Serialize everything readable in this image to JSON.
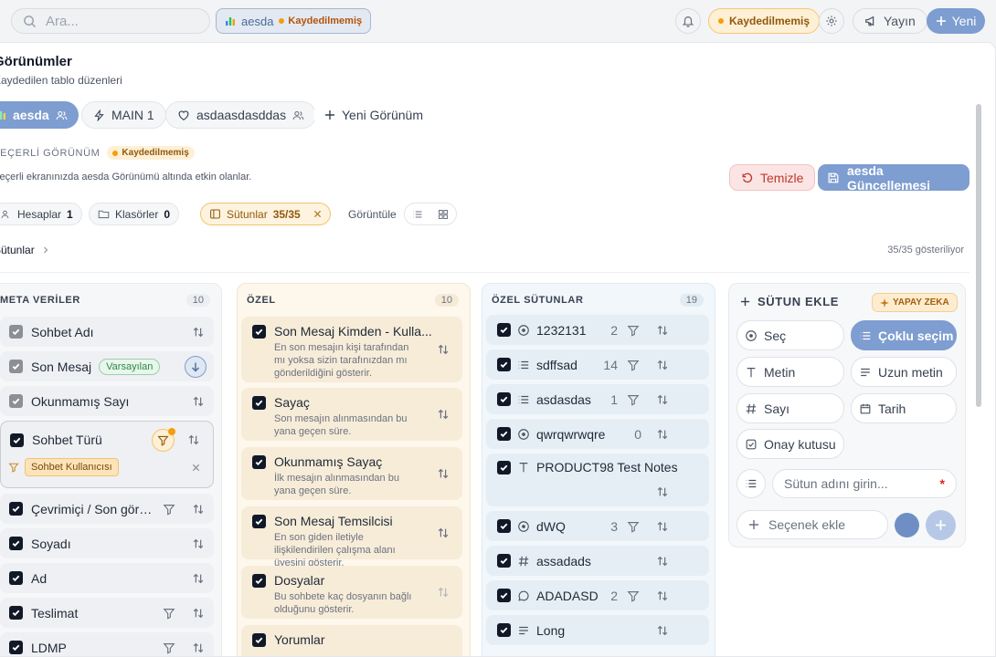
{
  "topbar": {
    "search_placeholder": "Ara...",
    "active_view": "aesda",
    "active_view_status": "Kaydedilmemiş",
    "unsaved_pill": "Kaydedilmemiş",
    "publish_label": "Yayın",
    "new_label": "Yeni"
  },
  "panel": {
    "title": "Görünümler",
    "subtitle": "Kaydedilen tablo düzenleri",
    "tabs": [
      {
        "label": "aesda"
      },
      {
        "label": "MAIN 1"
      },
      {
        "label": "asdaasdasddas"
      },
      {
        "label": "Yeni Görünüm"
      }
    ],
    "current_label": "GEÇERLİ GÖRÜNÜM",
    "current_status": "Kaydedilmemiş",
    "current_desc": "Geçerli ekranınızda aesda Görünümü altında etkin olanlar.",
    "clear_label": "Temizle",
    "update_label": "aesda Güncellemesi",
    "filters": [
      {
        "label": "Hesaplar",
        "count": "1"
      },
      {
        "label": "Klasörler",
        "count": "0"
      },
      {
        "label": "Sütunlar",
        "count": "35/35"
      }
    ],
    "show_label": "Görüntüle",
    "crumb_label": "Sütunlar",
    "count_label": "35/35 gösteriliyor"
  },
  "meta": {
    "title": "META VERİLER",
    "count": "10",
    "rows": [
      {
        "label": "Sohbet Adı"
      },
      {
        "label": "Son Mesaj",
        "badge": "Varsayılan"
      },
      {
        "label": "Okunmamış Sayı"
      },
      {
        "label": "Sohbet Türü",
        "filter_chip": "Sohbet Kullanıcısı"
      },
      {
        "label": "Çevrimiçi / Son görü..."
      },
      {
        "label": "Soyadı"
      },
      {
        "label": "Ad"
      },
      {
        "label": "Teslimat"
      },
      {
        "label": "LDMP"
      }
    ]
  },
  "ozel": {
    "title": "ÖZEL",
    "count": "10",
    "rows": [
      {
        "label": "Son Mesaj Kimden - Kulla...",
        "desc": "En son mesajın kişi tarafından mı yoksa sizin tarafınızdan mı gönderildiğini gösterir."
      },
      {
        "label": "Sayaç",
        "desc": "Son mesajın alınmasından bu yana geçen süre."
      },
      {
        "label": "Okunmamış Sayaç",
        "desc": "İlk mesajın alınmasından bu yana geçen süre."
      },
      {
        "label": "Son Mesaj Temsilcisi",
        "desc": "En son giden iletiyle ilişkilendirilen çalışma alanı üyesini gösterir."
      },
      {
        "label": "Dosyalar",
        "desc": "Bu sohbete kaç dosyanın bağlı olduğunu gösterir."
      },
      {
        "label": "Yorumlar",
        "desc": ""
      }
    ]
  },
  "custom": {
    "title": "ÖZEL SÜTUNLAR",
    "count": "19",
    "rows": [
      {
        "label": "1232131",
        "icon": "circle-dot-icon",
        "count": "2"
      },
      {
        "label": "sdffsad",
        "icon": "list-icon",
        "count": "14"
      },
      {
        "label": "asdasdas",
        "icon": "list-icon",
        "count": "1"
      },
      {
        "label": "qwrqwrwqre",
        "icon": "circle-dot-icon",
        "count": "0"
      },
      {
        "label": "PRODUCT98 Test Notes",
        "icon": "text-icon",
        "count": ""
      },
      {
        "label": "dWQ",
        "icon": "circle-dot-icon",
        "count": "3"
      },
      {
        "label": "assadads",
        "icon": "hash-icon",
        "count": ""
      },
      {
        "label": "ADADASD",
        "icon": "chat-icon",
        "count": "2"
      },
      {
        "label": "Long",
        "icon": "long-text-icon",
        "count": ""
      }
    ]
  },
  "add_column": {
    "title": "SÜTUN EKLE",
    "ai_badge": "YAPAY ZEKA",
    "types": [
      {
        "label": "Seç"
      },
      {
        "label": "Çoklu seçim"
      },
      {
        "label": "Metin"
      },
      {
        "label": "Uzun metin"
      },
      {
        "label": "Sayı"
      },
      {
        "label": "Tarih"
      },
      {
        "label": "Onay kutusu"
      }
    ],
    "name_placeholder": "Sütun adını girin...",
    "option_placeholder": "Seçenek ekle"
  },
  "colors": {
    "accent": "#7e9dd0",
    "warning": "#f59e0b",
    "danger": "#c0392b"
  }
}
